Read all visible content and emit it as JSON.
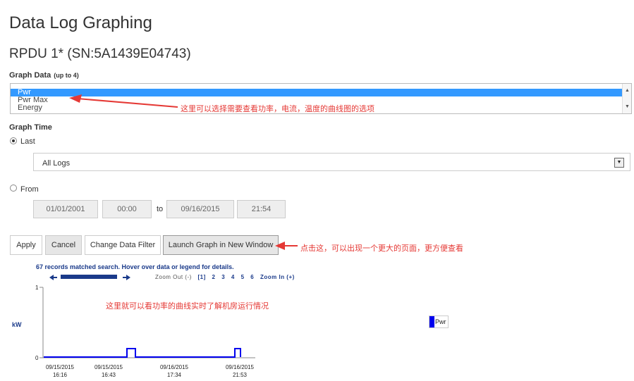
{
  "page": {
    "title": "Data Log Graphing",
    "device": "RPDU 1* (SN:5A1439E04743)"
  },
  "graph_data": {
    "label": "Graph Data",
    "hint": "(up to 4)",
    "options": [
      "Pwr",
      "Pwr Max",
      "Energy"
    ],
    "selected": "Pwr"
  },
  "graph_time": {
    "label": "Graph Time",
    "last_label": "Last",
    "last_value": "All Logs",
    "from_label": "From",
    "from_date": "01/01/2001",
    "from_time": "00:00",
    "to_label": "to",
    "to_date": "09/16/2015",
    "to_time": "21:54"
  },
  "buttons": {
    "apply": "Apply",
    "cancel": "Cancel",
    "change_filter": "Change Data Filter",
    "launch": "Launch Graph in New Window"
  },
  "annotations": {
    "list_note": "这里可以选择需要查看功率，电流，温度的曲线图的选项",
    "launch_note": "点击这，可以出现一个更大的页面，更方便查看",
    "graph_note": "这里就可以看功率的曲线实时了解机房运行情况"
  },
  "graph": {
    "records_text": "67 records matched search. Hover over data or legend for details.",
    "zoom_out": "Zoom Out (-)",
    "zoom_levels": [
      "[1]",
      "2",
      "3",
      "4",
      "5",
      "6"
    ],
    "zoom_in": "Zoom In (+)",
    "ylabel": "kW",
    "legend": "Pwr"
  },
  "chart_data": {
    "type": "line",
    "ylabel": "kW",
    "ylim": [
      0,
      1
    ],
    "yticks": [
      "1",
      "0"
    ],
    "xticks": [
      {
        "date": "09/15/2015",
        "time": "16:16"
      },
      {
        "date": "09/15/2015",
        "time": "16:43"
      },
      {
        "date": "09/16/2015",
        "time": "17:34"
      },
      {
        "date": "09/16/2015",
        "time": "21:53"
      }
    ],
    "series": [
      {
        "name": "Pwr",
        "color": "#0000ee"
      }
    ]
  }
}
